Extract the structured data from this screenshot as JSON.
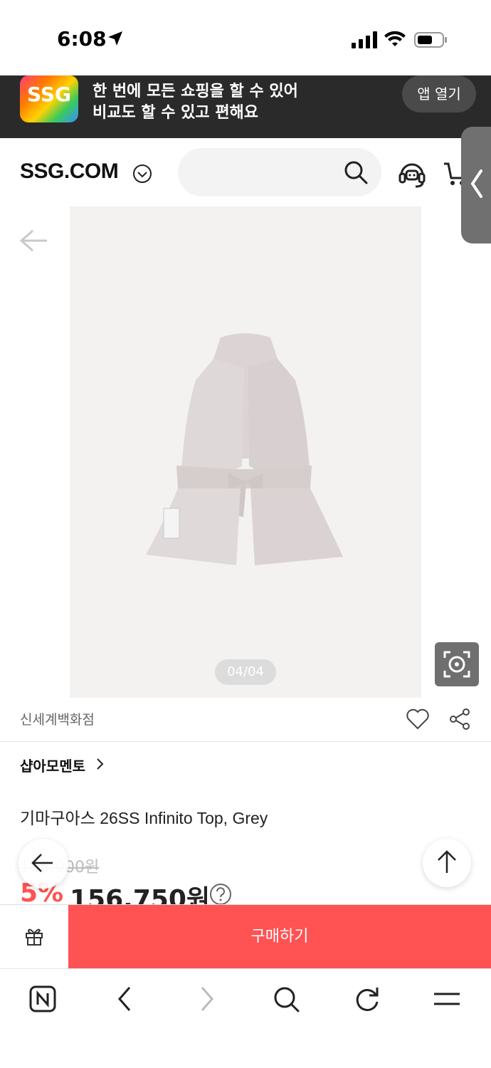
{
  "status_bar": {
    "time": "6:08"
  },
  "app_banner": {
    "logo_text": "SSG",
    "line1": "한 번에 모든 쇼핑을 할 수 있어",
    "line2": "비교도 할 수 있고 편해요",
    "open_app_label": "앱 열기"
  },
  "header": {
    "brand": "SSG.COM",
    "search_placeholder": ""
  },
  "gallery": {
    "page_counter": "04/04"
  },
  "product": {
    "store_name": "신세계백화점",
    "seller": "샵아모멘토",
    "title": "기마구아스 26SS Infinito Top, Grey",
    "original_price": "165,000원",
    "discount_rate": "5%",
    "sale_price": "156,750원"
  },
  "buy_bar": {
    "buy_label": "구매하기"
  },
  "colors": {
    "accent": "#ff5252",
    "banner_bg": "#2a2a2a"
  }
}
